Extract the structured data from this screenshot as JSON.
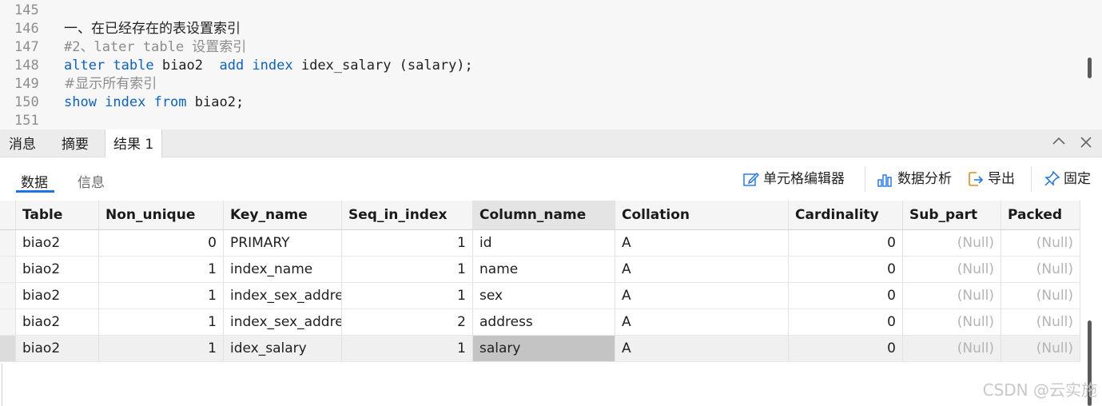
{
  "editor": {
    "lines": [
      {
        "num": "145",
        "tokens": []
      },
      {
        "num": "146",
        "tokens": [
          {
            "t": "一、在已经存在的表设置索引",
            "c": "t-tx"
          }
        ]
      },
      {
        "num": "147",
        "tokens": [
          {
            "t": "#2、later table ",
            "c": "t-cm"
          },
          {
            "t": "设置索引",
            "c": "t-cmcn"
          }
        ]
      },
      {
        "num": "148",
        "tokens": [
          {
            "t": "alter table",
            "c": "t-kw"
          },
          {
            "t": " biao2  ",
            "c": "t-tx"
          },
          {
            "t": "add index",
            "c": "t-kw"
          },
          {
            "t": " idex_salary (salary);",
            "c": "t-tx"
          }
        ]
      },
      {
        "num": "149",
        "tokens": [
          {
            "t": "#显示所有索引",
            "c": "t-cmcn"
          }
        ]
      },
      {
        "num": "150",
        "tokens": [
          {
            "t": "show index from",
            "c": "t-kw"
          },
          {
            "t": " biao2;",
            "c": "t-tx"
          }
        ]
      },
      {
        "num": "151",
        "tokens": []
      }
    ]
  },
  "panel_tabs": {
    "messages": "消息",
    "summary": "摘要",
    "result1": "结果 1",
    "collapse_icon": "chevron-up-icon",
    "close_icon": "close-icon"
  },
  "toolbar": {
    "tab_data": "数据",
    "tab_info": "信息",
    "cell_editor": "单元格编辑器",
    "data_analysis": "数据分析",
    "export": "导出",
    "pin": "固定"
  },
  "colors": {
    "keyword": "#0b62c9",
    "comment": "#8c8c8c",
    "accent": "#1a73e8",
    "null_text": "#b4b4b4"
  },
  "grid": {
    "columns": [
      "Table",
      "Non_unique",
      "Key_name",
      "Seq_in_index",
      "Column_name",
      "Collation",
      "Cardinality",
      "Sub_part",
      "Packed"
    ],
    "rows": [
      [
        "biao2",
        "0",
        "PRIMARY",
        "1",
        "id",
        "A",
        "0",
        "(Null)",
        "(Null)"
      ],
      [
        "biao2",
        "1",
        "index_name",
        "1",
        "name",
        "A",
        "0",
        "(Null)",
        "(Null)"
      ],
      [
        "biao2",
        "1",
        "index_sex_address",
        "1",
        "sex",
        "A",
        "0",
        "(Null)",
        "(Null)"
      ],
      [
        "biao2",
        "1",
        "index_sex_address",
        "2",
        "address",
        "A",
        "0",
        "(Null)",
        "(Null)"
      ],
      [
        "biao2",
        "1",
        "idex_salary",
        "1",
        "salary",
        "A",
        "0",
        "(Null)",
        "(Null)"
      ]
    ],
    "selected_row": 4,
    "selected_column": "Column_name"
  },
  "watermark": "CSDN @云实施"
}
